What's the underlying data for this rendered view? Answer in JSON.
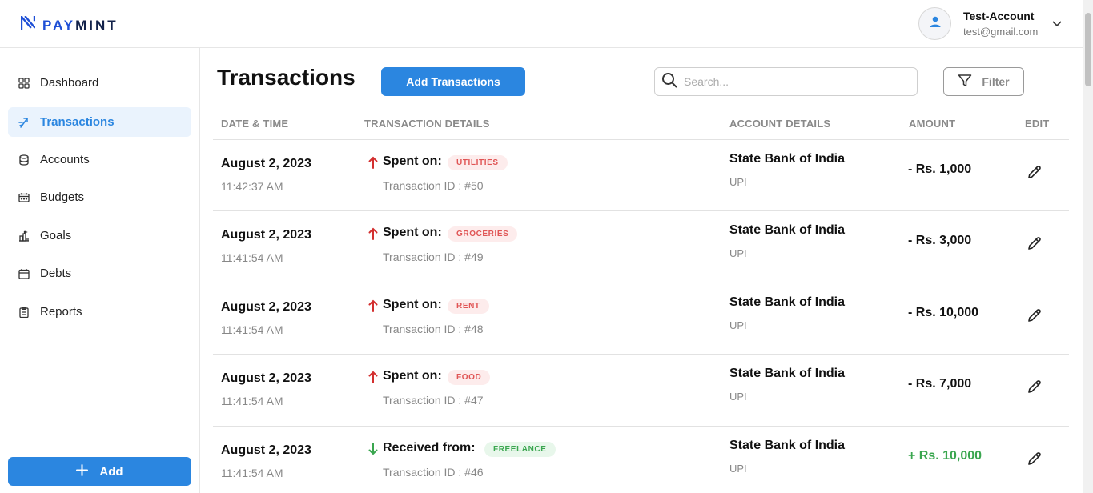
{
  "app": {
    "brand_prefix": "PAY",
    "brand_suffix": "MINT"
  },
  "user": {
    "name": "Test-Account",
    "email": "test@gmail.com"
  },
  "sidebar": {
    "items": [
      {
        "label": "Dashboard",
        "icon": "grid-icon"
      },
      {
        "label": "Transactions",
        "icon": "transfer-arrows-icon",
        "active": true
      },
      {
        "label": "Accounts",
        "icon": "database-icon"
      },
      {
        "label": "Budgets",
        "icon": "wallet-icon"
      },
      {
        "label": "Goals",
        "icon": "goal-icon"
      },
      {
        "label": "Debts",
        "icon": "calendar-icon"
      },
      {
        "label": "Reports",
        "icon": "clipboard-icon"
      }
    ],
    "add_label": "Add"
  },
  "main": {
    "title": "Transactions",
    "add_button": "Add Transactions",
    "search_placeholder": "Search...",
    "filter_label": "Filter",
    "columns": [
      "DATE & TIME",
      "TRANSACTION DETAILS",
      "ACCOUNT DETAILS",
      "AMOUNT",
      "EDIT"
    ]
  },
  "transactions": [
    {
      "date": "August 2, 2023",
      "time": "11:42:37 AM",
      "direction": "out",
      "kind": "Spent on:",
      "category": "UTILITIES",
      "txid": "Transaction ID : #50",
      "bank": "State Bank of India",
      "method": "UPI",
      "amount": "- Rs. 1,000"
    },
    {
      "date": "August 2, 2023",
      "time": "11:41:54 AM",
      "direction": "out",
      "kind": "Spent on:",
      "category": "GROCERIES",
      "txid": "Transaction ID : #49",
      "bank": "State Bank of India",
      "method": "UPI",
      "amount": "- Rs. 3,000"
    },
    {
      "date": "August 2, 2023",
      "time": "11:41:54 AM",
      "direction": "out",
      "kind": "Spent on:",
      "category": "RENT",
      "txid": "Transaction ID : #48",
      "bank": "State Bank of India",
      "method": "UPI",
      "amount": "- Rs. 10,000"
    },
    {
      "date": "August 2, 2023",
      "time": "11:41:54 AM",
      "direction": "out",
      "kind": "Spent on:",
      "category": "FOOD",
      "txid": "Transaction ID : #47",
      "bank": "State Bank of India",
      "method": "UPI",
      "amount": "- Rs. 7,000"
    },
    {
      "date": "August 2, 2023",
      "time": "11:41:54 AM",
      "direction": "in",
      "kind": "Received from:",
      "category": "FREELANCE",
      "txid": "Transaction ID : #46",
      "bank": "State Bank of India",
      "method": "UPI",
      "amount": "+ Rs. 10,000"
    }
  ],
  "colors": {
    "accent": "#2b86e0",
    "expense": "#d32f2f",
    "income": "#3aa64f"
  }
}
